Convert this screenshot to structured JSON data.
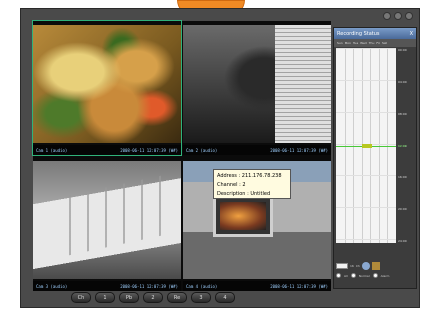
{
  "window": {
    "title": "",
    "controls": [
      "minimize",
      "maximize",
      "close"
    ]
  },
  "cameras": [
    {
      "id": "food",
      "label": "Cam 1 (audio)",
      "timestamp": "2008-06-11 12:07:39 (W#)"
    },
    {
      "id": "lab",
      "label": "Cam 2 (audio)",
      "timestamp": "2008-06-11 12:07:39 (W#)"
    },
    {
      "id": "shelf",
      "label": "Cam 3 (audio)",
      "timestamp": "2008-06-11 12:07:39 (W#)"
    },
    {
      "id": "desk",
      "label": "Cam 4 (audio)",
      "timestamp": "2008-06-11 12:07:39 (W#)"
    }
  ],
  "tooltip": {
    "address": "Address : 211.176.78.238",
    "channel": "Channel : 2",
    "description": "Description : Untitled"
  },
  "controls": {
    "buttons": [
      "Ch",
      "1",
      "Pb",
      "2",
      "Re",
      "3",
      "4"
    ]
  },
  "recording_panel": {
    "title": "Recording Status",
    "close_label": "X",
    "days": [
      "Sun",
      "Mon",
      "Tue",
      "Wed",
      "Thu",
      "Fri",
      "Sat"
    ],
    "time_labels": [
      "00:00",
      "04:00",
      "08:00",
      "12:00",
      "16:00",
      "20:00",
      "24:00"
    ],
    "current_time_label": "12:07",
    "current_day_index": 3,
    "current_time_fraction": 0.505,
    "channel_count": "16",
    "channel_unit": "Ch",
    "radio_options": [
      "All",
      "Normal",
      "Alarm"
    ],
    "accent_color": "#48c838"
  }
}
